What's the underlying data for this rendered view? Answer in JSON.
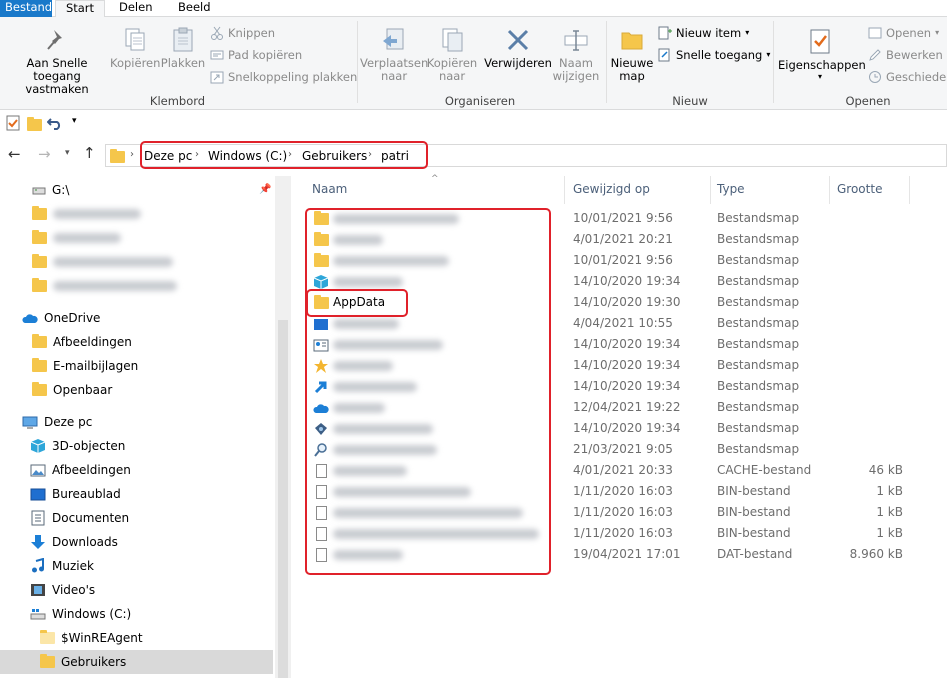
{
  "tabs": {
    "file": "Bestand",
    "start": "Start",
    "share": "Delen",
    "view": "Beeld"
  },
  "ribbon": {
    "pin": "Aan Snelle toegang\nvastmaken",
    "copy": "Kopiëren",
    "paste": "Plakken",
    "cut": "Knippen",
    "copy_path": "Pad kopiëren",
    "paste_shortcut": "Snelkoppeling plakken",
    "group_clipboard": "Klembord",
    "move_to": "Verplaatsen\nnaar",
    "copy_to": "Kopiëren\nnaar",
    "delete": "Verwijderen",
    "rename": "Naam\nwijzigen",
    "group_organize": "Organiseren",
    "new_folder": "Nieuwe\nmap",
    "new_item": "Nieuw item",
    "easy_access": "Snelle toegang",
    "group_new": "Nieuw",
    "properties": "Eigenschappen",
    "open": "Openen",
    "edit": "Bewerken",
    "history": "Geschiedenis",
    "group_open": "Openen"
  },
  "address": {
    "crumbs": [
      "Deze pc",
      "Windows (C:)",
      "Gebruikers",
      "patri"
    ]
  },
  "nav": {
    "drive_g": "G:\\",
    "onedrive": "OneDrive",
    "od_items": [
      "Afbeeldingen",
      "E-mailbijlagen",
      "Openbaar"
    ],
    "this_pc": "Deze pc",
    "pc_items": [
      "3D-objecten",
      "Afbeeldingen",
      "Bureaublad",
      "Documenten",
      "Downloads",
      "Muziek",
      "Video's",
      "Windows (C:)"
    ],
    "c_items": [
      "$WinREAgent",
      "Gebruikers"
    ]
  },
  "columns": {
    "name": "Naam",
    "modified": "Gewijzigd op",
    "type": "Type",
    "size": "Grootte"
  },
  "files": [
    {
      "name": "",
      "date": "10/01/2021 9:56",
      "type": "Bestandsmap",
      "size": "",
      "icon": "folder-icon"
    },
    {
      "name": "",
      "date": "4/01/2021 20:21",
      "type": "Bestandsmap",
      "size": "",
      "icon": "folder-icon"
    },
    {
      "name": "",
      "date": "10/01/2021 9:56",
      "type": "Bestandsmap",
      "size": "",
      "icon": "folder-icon"
    },
    {
      "name": "",
      "date": "14/10/2020 19:34",
      "type": "Bestandsmap",
      "size": "",
      "icon": "3d-objects-icon"
    },
    {
      "name": "AppData",
      "date": "14/10/2020 19:30",
      "type": "Bestandsmap",
      "size": "",
      "icon": "folder-icon"
    },
    {
      "name": "",
      "date": "4/04/2021 10:55",
      "type": "Bestandsmap",
      "size": "",
      "icon": "desktop-icon"
    },
    {
      "name": "",
      "date": "14/10/2020 19:34",
      "type": "Bestandsmap",
      "size": "",
      "icon": "contacts-icon"
    },
    {
      "name": "",
      "date": "14/10/2020 19:34",
      "type": "Bestandsmap",
      "size": "",
      "icon": "favorites-icon"
    },
    {
      "name": "",
      "date": "14/10/2020 19:34",
      "type": "Bestandsmap",
      "size": "",
      "icon": "links-icon"
    },
    {
      "name": "",
      "date": "12/04/2021 19:22",
      "type": "Bestandsmap",
      "size": "",
      "icon": "onedrive-icon"
    },
    {
      "name": "",
      "date": "14/10/2020 19:34",
      "type": "Bestandsmap",
      "size": "",
      "icon": "saved-games-icon"
    },
    {
      "name": "",
      "date": "21/03/2021 9:05",
      "type": "Bestandsmap",
      "size": "",
      "icon": "searches-icon"
    },
    {
      "name": "",
      "date": "4/01/2021 20:33",
      "type": "CACHE-bestand",
      "size": "46 kB",
      "icon": "file-icon"
    },
    {
      "name": "",
      "date": "1/11/2020 16:03",
      "type": "BIN-bestand",
      "size": "1 kB",
      "icon": "file-icon"
    },
    {
      "name": "",
      "date": "1/11/2020 16:03",
      "type": "BIN-bestand",
      "size": "1 kB",
      "icon": "file-icon"
    },
    {
      "name": "",
      "date": "1/11/2020 16:03",
      "type": "BIN-bestand",
      "size": "1 kB",
      "icon": "file-icon"
    },
    {
      "name": "",
      "date": "19/04/2021 17:01",
      "type": "DAT-bestand",
      "size": "8.960 kB",
      "icon": "file-icon"
    }
  ],
  "colors": {
    "highlight": "#e0212a",
    "file_tab": "#1979ca",
    "folder": "#f5c64b"
  }
}
